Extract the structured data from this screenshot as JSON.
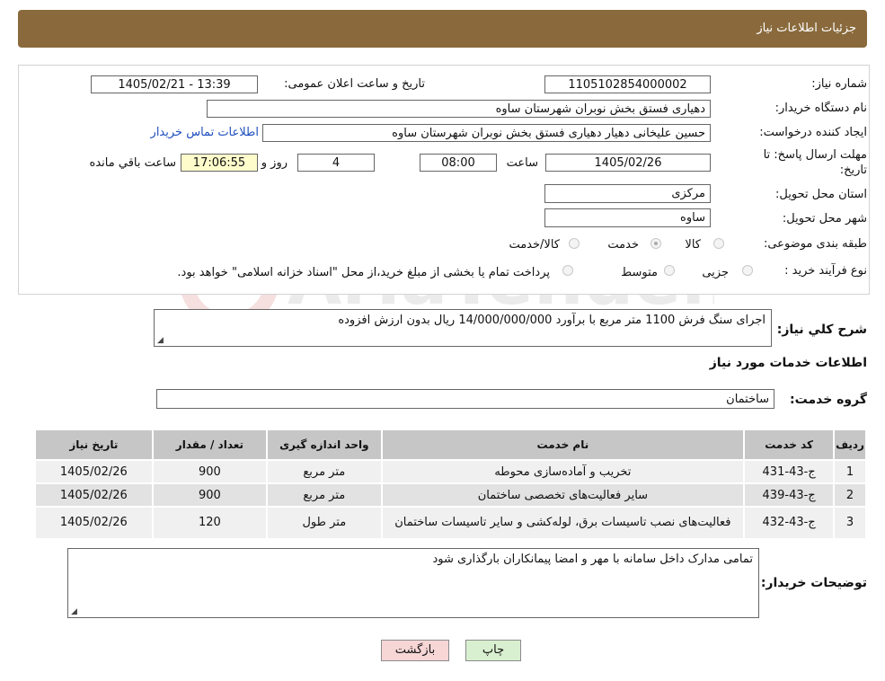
{
  "header": {
    "title": "جزئیات اطلاعات نیاز"
  },
  "form": {
    "need_number_label": "شماره نیاز:",
    "need_number": "1105102854000002",
    "announce_label": "تاریخ و ساعت اعلان عمومی:",
    "announce_value": "1405/02/21 - 13:39",
    "buyer_org_label": "نام دستگاه خریدار:",
    "buyer_org": "دهیاری فستق بخش نوبران شهرستان ساوه",
    "requester_label": "ایجاد کننده درخواست:",
    "requester": "حسین علیخانی دهیار دهیاری فستق بخش نوبران شهرستان ساوه",
    "contact_link": "اطلاعات تماس خریدار",
    "deadline_label_1": "مهلت ارسال پاسخ: تا",
    "deadline_label_2": "تاریخ:",
    "deadline_date": "1405/02/26",
    "time_label": "ساعت",
    "deadline_time": "08:00",
    "days_value": "4",
    "days_label": "روز و",
    "remaining_time": "17:06:55",
    "remaining_label": "ساعت باقي مانده",
    "province_label": "استان محل تحویل:",
    "province": "مرکزی",
    "city_label": "شهر محل تحویل:",
    "city": "ساوه",
    "category_label": "طبقه بندی موضوعی:",
    "category_options": [
      "کالا",
      "خدمت",
      "کالا/خدمت"
    ],
    "category_selected": "خدمت",
    "process_label": "نوع فرآیند خرید :",
    "process_options": [
      "جزیی",
      "متوسط"
    ],
    "process_note": "پرداخت تمام یا بخشی از مبلغ خرید،از محل \"اسناد خزانه اسلامی\" خواهد بود."
  },
  "summary": {
    "label": "شرح کلي نياز:",
    "text": "اجرای سنگ فرش 1100 متر مربع با برآورد 14/000/000/000 ریال بدون ارزش افزوده"
  },
  "services": {
    "section_title": "اطلاعات خدمات مورد نیاز",
    "group_label": "گروه خدمت:",
    "group_value": "ساختمان",
    "columns": [
      "ردیف",
      "کد خدمت",
      "نام خدمت",
      "واحد اندازه گیری",
      "تعداد / مقدار",
      "تاریخ نیاز"
    ],
    "rows": [
      {
        "index": "1",
        "code": "ج-43-431",
        "name": "تخریب و آماده‌سازی محوطه",
        "unit": "متر مربع",
        "qty": "900",
        "date": "1405/02/26"
      },
      {
        "index": "2",
        "code": "ج-43-439",
        "name": "سایر فعالیت‌های تخصصی ساختمان",
        "unit": "متر مربع",
        "qty": "900",
        "date": "1405/02/26"
      },
      {
        "index": "3",
        "code": "ج-43-432",
        "name": "فعالیت‌های نصب تاسیسات برق، لوله‌کشی و سایر تاسیسات ساختمان",
        "unit": "متر طول",
        "qty": "120",
        "date": "1405/02/26"
      }
    ]
  },
  "notes": {
    "label": "توضیحات خریدار:",
    "text": "تمامی مدارک داخل سامانه با مهر و امضا پیمانکاران بارگذاری شود"
  },
  "buttons": {
    "print": "چاپ",
    "back": "بازگشت"
  },
  "watermark": {
    "text": "AriaTender.neT"
  },
  "colors": {
    "header_bg": "#8a6a3c",
    "table_header_bg": "#c6c6c6",
    "back_button_bg": "#f7d6d6",
    "print_button_bg": "#d8f0d0"
  }
}
